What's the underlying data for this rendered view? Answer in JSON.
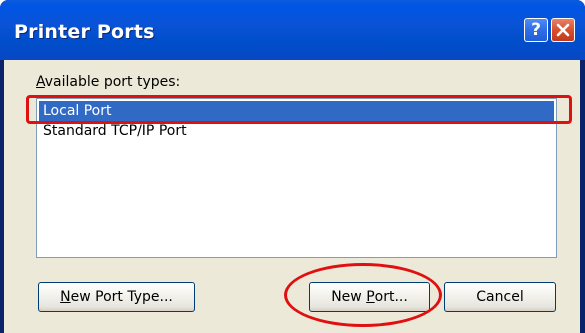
{
  "window": {
    "title": "Printer Ports",
    "help_glyph": "?",
    "close_icon": "close-icon"
  },
  "dialog": {
    "list_label": "Available port types:",
    "list_label_accel": "A",
    "list_label_rest": "vailable port types:",
    "port_types": [
      {
        "label": "Local Port",
        "selected": true
      },
      {
        "label": "Standard TCP/IP Port",
        "selected": false
      }
    ]
  },
  "buttons": {
    "new_port_type": {
      "accel": "N",
      "rest": "ew Port Type..."
    },
    "new_port": {
      "before": "New ",
      "accel": "P",
      "rest": "ort..."
    },
    "cancel": "Cancel"
  },
  "colors": {
    "titlebar": "#0055e5",
    "selection": "#316ac5",
    "annotation": "#e01010",
    "client_bg": "#ece9d8"
  }
}
